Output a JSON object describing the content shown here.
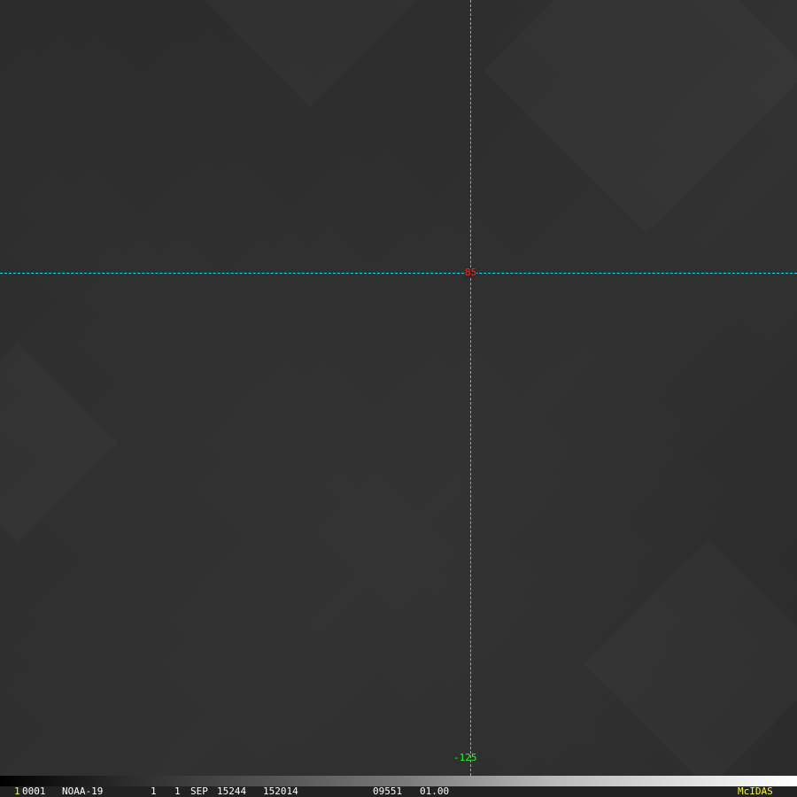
{
  "overlay": {
    "lat_label": "85",
    "lon_label": "-125",
    "line_color": "#00e5ee",
    "lat_color": "#ff2020",
    "lon_color": "#20ff20"
  },
  "status": {
    "frame": "1",
    "image_id": "0001",
    "satellite": "NOAA-19",
    "band": "1",
    "res": "1",
    "month": "SEP",
    "date": "15244",
    "time": "152014",
    "line": "09551",
    "scale": "01.00",
    "brand": "McIDAS"
  }
}
